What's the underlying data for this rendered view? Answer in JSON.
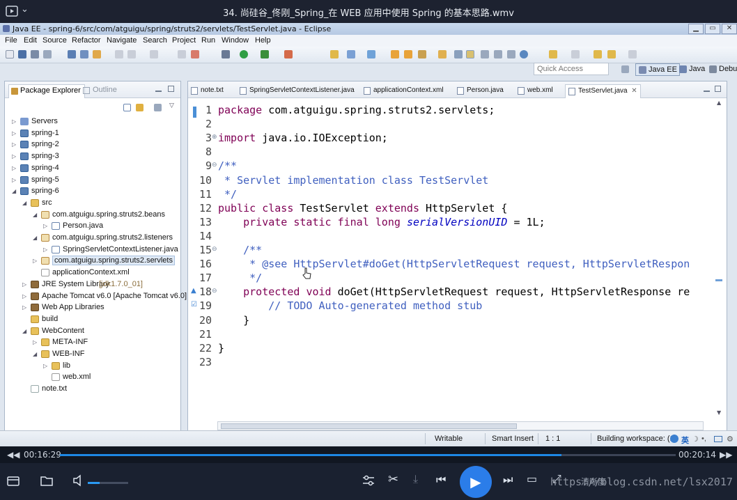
{
  "player": {
    "title": "34. 尚硅谷_佟刚_Spring_在 WEB 应用中使用 Spring 的基本思路.wmv",
    "time_elapsed": "00:16:29",
    "time_total": "00:20:14",
    "progress": 0.815,
    "volume": 0.3,
    "watermark": "https://blog.csdn.net/lsx2017",
    "clear_label": "清晰度"
  },
  "window": {
    "title": "Java EE - spring-6/src/com/atguigu/spring/struts2/servlets/TestServlet.java - Eclipse"
  },
  "menu": [
    "File",
    "Edit",
    "Source",
    "Refactor",
    "Navigate",
    "Search",
    "Project",
    "Run",
    "Window",
    "Help"
  ],
  "toolbar": {
    "quick_access": "Quick Access",
    "perspectives": [
      "Java EE",
      "Java",
      "Debu"
    ]
  },
  "explorer": {
    "tab_package": "Package Explorer",
    "tab_outline": "Outline",
    "tree": [
      {
        "label": "Servers",
        "depth": 0,
        "icon": "srv",
        "exp": "closed"
      },
      {
        "label": "spring-1",
        "depth": 0,
        "icon": "prj",
        "exp": "closed"
      },
      {
        "label": "spring-2",
        "depth": 0,
        "icon": "prj",
        "exp": "closed"
      },
      {
        "label": "spring-3",
        "depth": 0,
        "icon": "prj",
        "exp": "closed"
      },
      {
        "label": "spring-4",
        "depth": 0,
        "icon": "prj",
        "exp": "closed"
      },
      {
        "label": "spring-5",
        "depth": 0,
        "icon": "prj",
        "exp": "closed"
      },
      {
        "label": "spring-6",
        "depth": 0,
        "icon": "prj",
        "exp": "open"
      },
      {
        "label": "src",
        "depth": 1,
        "icon": "fold",
        "exp": "open"
      },
      {
        "label": "com.atguigu.spring.struts2.beans",
        "depth": 2,
        "icon": "pk",
        "exp": "open"
      },
      {
        "label": "Person.java",
        "depth": 3,
        "icon": "jv",
        "exp": "closed"
      },
      {
        "label": "com.atguigu.spring.struts2.listeners",
        "depth": 2,
        "icon": "pk",
        "exp": "open"
      },
      {
        "label": "SpringServletContextListener.java",
        "depth": 3,
        "icon": "jv",
        "exp": "closed"
      },
      {
        "label": "com.atguigu.spring.struts2.servlets",
        "depth": 2,
        "icon": "pk",
        "exp": "closed",
        "selected": true
      },
      {
        "label": "applicationContext.xml",
        "depth": 2,
        "icon": "xml",
        "exp": "none"
      },
      {
        "label": "JRE System Library",
        "extra": "[jdk1.7.0_01]",
        "depth": 1,
        "icon": "lib",
        "exp": "closed"
      },
      {
        "label": "Apache Tomcat v6.0 [Apache Tomcat v6.0]",
        "depth": 1,
        "icon": "lib",
        "exp": "closed"
      },
      {
        "label": "Web App Libraries",
        "depth": 1,
        "icon": "lib",
        "exp": "closed"
      },
      {
        "label": "build",
        "depth": 1,
        "icon": "fold",
        "exp": "none"
      },
      {
        "label": "WebContent",
        "depth": 1,
        "icon": "fold",
        "exp": "open"
      },
      {
        "label": "META-INF",
        "depth": 2,
        "icon": "fold",
        "exp": "closed"
      },
      {
        "label": "WEB-INF",
        "depth": 2,
        "icon": "fold",
        "exp": "open"
      },
      {
        "label": "lib",
        "depth": 3,
        "icon": "fold",
        "exp": "closed"
      },
      {
        "label": "web.xml",
        "depth": 3,
        "icon": "xml",
        "exp": "none"
      },
      {
        "label": "note.txt",
        "depth": 1,
        "icon": "txt",
        "exp": "none"
      }
    ]
  },
  "editor": {
    "tabs": [
      {
        "label": "note.txt"
      },
      {
        "label": "SpringServletContextListener.java"
      },
      {
        "label": "applicationContext.xml"
      },
      {
        "label": "Person.java"
      },
      {
        "label": "web.xml"
      },
      {
        "label": "TestServlet.java",
        "active": true
      }
    ],
    "lines": [
      {
        "n": "1",
        "segs": [
          [
            "kw",
            "package"
          ],
          [
            "",
            "com.atguigu.spring.struts2.servlets;"
          ]
        ]
      },
      {
        "n": "2",
        "segs": []
      },
      {
        "n": "3",
        "fold": "⊕",
        "segs": [
          [
            "kw",
            "import"
          ],
          [
            "",
            "java.io.IOException;"
          ]
        ]
      },
      {
        "n": "8",
        "segs": []
      },
      {
        "n": "9",
        "fold": "⊖",
        "segs": [
          [
            "cm",
            "/**"
          ]
        ]
      },
      {
        "n": "10",
        "segs": [
          [
            "cm",
            " * Servlet implementation class TestServlet"
          ]
        ]
      },
      {
        "n": "11",
        "segs": [
          [
            "cm",
            " */"
          ]
        ]
      },
      {
        "n": "12",
        "segs": [
          [
            "kw",
            "public"
          ],
          [
            "kw",
            "class"
          ],
          [
            "",
            "TestServlet"
          ],
          [
            "kw",
            "extends"
          ],
          [
            "",
            "HttpServlet {"
          ]
        ]
      },
      {
        "n": "13",
        "segs": [
          [
            "kw",
            "    private"
          ],
          [
            "kw",
            "static"
          ],
          [
            "kw",
            "final"
          ],
          [
            "kw",
            "long"
          ],
          [
            "it",
            "serialVersionUID"
          ],
          [
            "",
            "= 1L;"
          ]
        ]
      },
      {
        "n": "14",
        "segs": []
      },
      {
        "n": "15",
        "fold": "⊖",
        "segs": [
          [
            "cm",
            "    /**"
          ]
        ]
      },
      {
        "n": "16",
        "segs": [
          [
            "cm",
            "     * @see HttpServlet#doGet(HttpServletRequest request, HttpServletRespon"
          ]
        ]
      },
      {
        "n": "17",
        "segs": [
          [
            "cm",
            "     */"
          ]
        ]
      },
      {
        "n": "18",
        "fold": "⊖",
        "mark": "▲",
        "segs": [
          [
            "kw",
            "    protected"
          ],
          [
            "kw",
            "void"
          ],
          [
            "",
            "doGet(HttpServletRequest request, HttpServletResponse re"
          ]
        ]
      },
      {
        "n": "19",
        "mark": "☑",
        "segs": [
          [
            "cm",
            "        // TODO Auto-generated method stub"
          ]
        ]
      },
      {
        "n": "20",
        "segs": [
          [
            "",
            "    }"
          ]
        ]
      },
      {
        "n": "21",
        "segs": []
      },
      {
        "n": "22",
        "segs": [
          [
            "",
            "}"
          ]
        ]
      },
      {
        "n": "23",
        "segs": []
      }
    ]
  },
  "status": {
    "writable": "Writable",
    "insert": "Smart Insert",
    "position": "1 : 1",
    "task": "Building workspace: (1"
  },
  "colors": {
    "accent": "#1e88e5",
    "keyword": "#7f0055",
    "comment": "#3f5fbf"
  }
}
